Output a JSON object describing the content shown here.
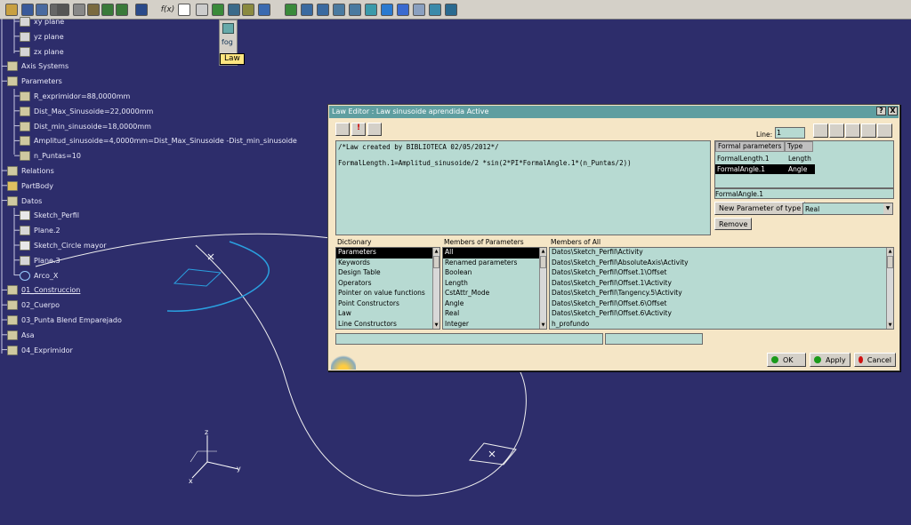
{
  "toolbar": {
    "icons": [
      "open-icon",
      "save-icon",
      "save-all-icon",
      "print-icon",
      "cut-icon",
      "copy-icon",
      "paste-icon",
      "undo-icon",
      "redo-icon",
      "whats-this-icon",
      "formula-icon",
      "comment-icon",
      "link-icon",
      "law-icon",
      "law-editor-icon",
      "parameter-icon",
      "select-icon",
      "fit-all-icon",
      "pan-icon",
      "rotate-icon",
      "zoom-in-icon",
      "zoom-out-icon",
      "normal-view-icon",
      "views-icon",
      "iso-view-icon",
      "render-style-icon",
      "hide-show-icon",
      "swap-space-icon"
    ],
    "formula_label": "f(x)",
    "law_tooltip": "Law"
  },
  "tree": {
    "nodes": [
      {
        "name": "tree-node-xy-plane",
        "label": "xy plane",
        "icon": "plane-icon"
      },
      {
        "name": "tree-node-yz-plane",
        "label": "yz plane",
        "icon": "plane-icon"
      },
      {
        "name": "tree-node-zx-plane",
        "label": "zx plane",
        "icon": "plane-icon"
      },
      {
        "name": "tree-node-axis-systems",
        "label": "Axis Systems",
        "icon": "folder-icon"
      },
      {
        "name": "tree-node-parameters",
        "label": "Parameters",
        "icon": "parameters-icon"
      },
      {
        "name": "tree-node-r-exprimidor",
        "label": "R_exprimidor=88,0000mm",
        "icon": "parameter-icon"
      },
      {
        "name": "tree-node-dist-max",
        "label": "Dist_Max_Sinusoide=22,0000mm",
        "icon": "parameter-icon"
      },
      {
        "name": "tree-node-dist-min",
        "label": "Dist_min_sinusoide=18,0000mm",
        "icon": "parameter-icon"
      },
      {
        "name": "tree-node-amplitud",
        "label": "Amplitud_sinusoide=4,0000mm=Dist_Max_Sinusoide -Dist_min_sinusoide",
        "icon": "formula-icon"
      },
      {
        "name": "tree-node-n-puntas",
        "label": "n_Puntas=10",
        "icon": "parameter-icon"
      },
      {
        "name": "tree-node-relations",
        "label": "Relations",
        "icon": "relations-icon"
      },
      {
        "name": "tree-node-partbody",
        "label": "PartBody",
        "icon": "body-icon"
      },
      {
        "name": "tree-node-datos",
        "label": "Datos",
        "icon": "geoset-icon"
      },
      {
        "name": "tree-node-sketch-perfil",
        "label": "Sketch_Perfil",
        "icon": "sketch-icon"
      },
      {
        "name": "tree-node-plane-2",
        "label": "Plane.2",
        "icon": "plane-icon"
      },
      {
        "name": "tree-node-sketch-circle",
        "label": "Sketch_Circle mayor",
        "icon": "sketch-icon"
      },
      {
        "name": "tree-node-plane-3",
        "label": "Plane.3",
        "icon": "plane-icon"
      },
      {
        "name": "tree-node-arco-x",
        "label": "Arco_X",
        "icon": "circle-icon"
      },
      {
        "name": "tree-node-01-construccion",
        "label": "01_Construccion",
        "icon": "geoset-icon"
      },
      {
        "name": "tree-node-02-cuerpo",
        "label": "02_Cuerpo",
        "icon": "geoset-icon"
      },
      {
        "name": "tree-node-03-punta",
        "label": "03_Punta Blend Emparejado",
        "icon": "geoset-icon"
      },
      {
        "name": "tree-node-asa",
        "label": "Asa",
        "icon": "geoset-icon"
      },
      {
        "name": "tree-node-04-exprimidor",
        "label": "04_Exprimidor",
        "icon": "geoset-icon"
      }
    ]
  },
  "compass": {
    "x": "x",
    "y": "y",
    "z": "z"
  },
  "dialog": {
    "title": "Law Editor : Law sinusoide aprendida Active",
    "help_btn": "?",
    "close_btn": "X",
    "line_label": "Line:",
    "line_value": "1",
    "editor_text": "/*Law created by BIBLIOTECA 02/05/2012*/\n\nFormalLength.1=Amplitud_sinusoide/2 *sin(2*PI*FormalAngle.1*(n_Puntas/2))",
    "formal_params": {
      "header_name": "Formal parameters",
      "header_type": "Type",
      "rows": [
        {
          "name": "FormalLength.1",
          "type": "Length"
        },
        {
          "name": "FormalAngle.1",
          "type": "Angle"
        }
      ],
      "selected_index": 1
    },
    "current_param_name": "FormalAngle.1",
    "new_param_btn": "New Parameter of type",
    "new_param_type": "Real",
    "remove_btn": "Remove",
    "dictionary": {
      "label": "Dictionary",
      "items": [
        "Parameters",
        "Keywords",
        "Design Table",
        "Operators",
        "Pointer on value functions",
        "Point Constructors",
        "Law",
        "Line Constructors"
      ],
      "selected_index": 0
    },
    "members_params": {
      "label": "Members of Parameters",
      "items": [
        "All",
        "Renamed parameters",
        "Boolean",
        "Length",
        "CstAttr_Mode",
        "Angle",
        "Real",
        "Integer"
      ],
      "selected_index": 0
    },
    "members_all": {
      "label": "Members of All",
      "items": [
        "Datos\\Sketch_Perfil\\Activity",
        "Datos\\Sketch_Perfil\\AbsoluteAxis\\Activity",
        "Datos\\Sketch_Perfil\\Offset.1\\Offset",
        "Datos\\Sketch_Perfil\\Offset.1\\Activity",
        "Datos\\Sketch_Perfil\\Tangency.5\\Activity",
        "Datos\\Sketch_Perfil\\Offset.6\\Offset",
        "Datos\\Sketch_Perfil\\Offset.6\\Activity",
        "h_profundo"
      ]
    },
    "ok_btn": "OK",
    "apply_btn": "Apply",
    "cancel_btn": "Cancel",
    "colors": {
      "ok": "#1a9a1a",
      "apply": "#1a9a1a",
      "cancel": "#d01010",
      "title_bar": "#5f9ea0",
      "panel": "#b7dad2"
    }
  }
}
